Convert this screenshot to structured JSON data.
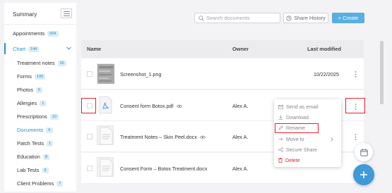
{
  "sidebar": {
    "summary_label": "Summary",
    "items": [
      {
        "label": "Appointments",
        "badge": "604"
      },
      {
        "label": "Chart",
        "badge": "144"
      }
    ],
    "subitems": [
      {
        "label": "Treatment notes",
        "badge": "36"
      },
      {
        "label": "Forms",
        "badge": "100"
      },
      {
        "label": "Photos",
        "badge": "5"
      },
      {
        "label": "Allergies",
        "badge": "1"
      },
      {
        "label": "Prescriptions",
        "badge": "10"
      },
      {
        "label": "Documents",
        "badge": "6"
      },
      {
        "label": "Patch Tests",
        "badge": "1"
      },
      {
        "label": "Education",
        "badge": "8"
      },
      {
        "label": "Lab Tests",
        "badge": "6"
      },
      {
        "label": "Client Problems",
        "badge": "7"
      }
    ]
  },
  "toolbar": {
    "search_placeholder": "Search documents",
    "share_history_label": "Share History",
    "create_label": "+ Create"
  },
  "table": {
    "columns": [
      "Name",
      "Owner",
      "Last modified"
    ],
    "rows": [
      {
        "name": "Screenshot_1.png",
        "owner": "",
        "date": "10/22/2025"
      },
      {
        "name": "Consent form Botox.pdf",
        "owner": "Alex A.",
        "date": ""
      },
      {
        "name": "Treatment Notes – Skin Peel.docx",
        "owner": "Alex A.",
        "date": ""
      },
      {
        "name": "Consent Form – Botox Treatment.docx",
        "owner": "Alex A.",
        "date": ""
      }
    ]
  },
  "context_menu": {
    "items": [
      "Send as email",
      "Download",
      "Rename",
      "Move to",
      "Secure Share",
      "Delete"
    ]
  },
  "colors": {
    "accent": "#2a93c8",
    "create_button": "#5aaee0",
    "highlight": "#e0232e",
    "delete": "#e0232e"
  },
  "icons": {
    "search": "search-icon",
    "history": "history-icon",
    "pdf": "pdf-icon",
    "eye": "eye-icon",
    "kebab": "more-vertical-icon",
    "calendar": "calendar-icon",
    "add": "add-icon"
  }
}
